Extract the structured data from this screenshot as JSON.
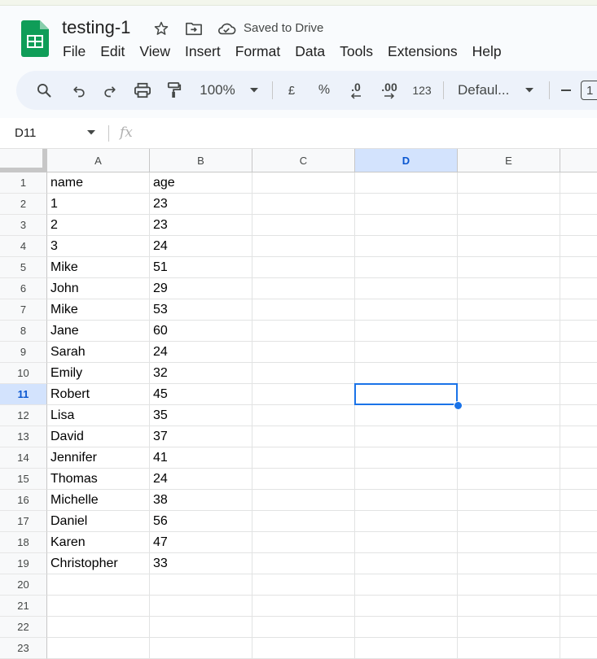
{
  "app": {
    "doc_title": "testing-1",
    "save_status": "Saved to Drive",
    "colors": {
      "brand_green": "#0f9d58",
      "selection_blue": "#1a73e8",
      "header_selected_bg": "#d3e3fd"
    }
  },
  "menu": [
    "File",
    "Edit",
    "View",
    "Insert",
    "Format",
    "Data",
    "Tools",
    "Extensions",
    "Help"
  ],
  "toolbar": {
    "zoom": "100%",
    "currency": "£",
    "percent": "%",
    "decrease_decimal": ".0",
    "increase_decimal": ".00",
    "number_format": "123",
    "font": "Defaul...",
    "font_size_partial": "1"
  },
  "formula_bar": {
    "namebox": "D11",
    "fx": "fx",
    "value": ""
  },
  "sheet": {
    "columns": [
      "A",
      "B",
      "C",
      "D",
      "E"
    ],
    "selected_column": "D",
    "selected_row": 11,
    "rows": [
      [
        "name",
        "age"
      ],
      [
        "1",
        "23"
      ],
      [
        "2",
        "23"
      ],
      [
        "3",
        "24"
      ],
      [
        "Mike",
        "51"
      ],
      [
        "John",
        "29"
      ],
      [
        "Mike",
        "53"
      ],
      [
        "Jane",
        "60"
      ],
      [
        "Sarah",
        "24"
      ],
      [
        "Emily",
        "32"
      ],
      [
        "Robert",
        "45"
      ],
      [
        "Lisa",
        "35"
      ],
      [
        "David",
        "37"
      ],
      [
        "Jennifer",
        "41"
      ],
      [
        "Thomas",
        "24"
      ],
      [
        "Michelle",
        "38"
      ],
      [
        "Daniel",
        "56"
      ],
      [
        "Karen",
        "47"
      ],
      [
        "Christopher",
        "33"
      ],
      [
        "",
        ""
      ],
      [
        "",
        ""
      ],
      [
        "",
        ""
      ],
      [
        "",
        ""
      ]
    ]
  }
}
